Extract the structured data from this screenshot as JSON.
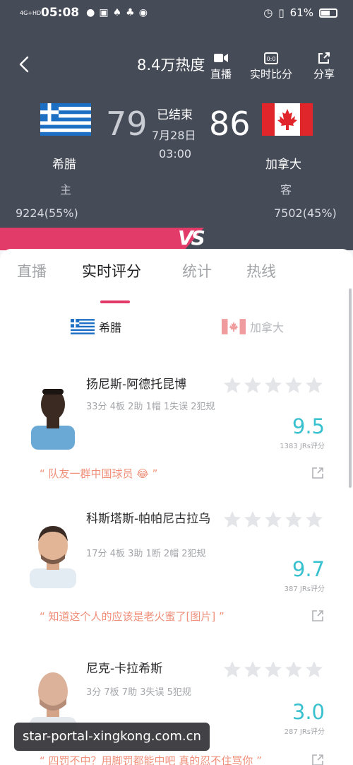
{
  "status_bar": {
    "network": "4G+HD",
    "time": "05:08",
    "battery": "61%",
    "battery_level": 0.61
  },
  "header": {
    "heat": "8.4万热度",
    "actions": {
      "live": "直播",
      "realtime_score": "实时比分",
      "share": "分享"
    },
    "game": {
      "status": "已结束",
      "date": "7月28日",
      "time": "03:00"
    },
    "home": {
      "name": "希腊",
      "role": "主",
      "score": "79",
      "votes": "9224(55%)",
      "support_share": 0.55
    },
    "away": {
      "name": "加拿大",
      "role": "客",
      "score": "86",
      "votes": "7502(45%)",
      "support_share": 0.45
    },
    "vs_label": "VS"
  },
  "tabs": [
    "直播",
    "实时评分",
    "统计",
    "热线"
  ],
  "active_tab": "实时评分",
  "team_switch": {
    "home": "希腊",
    "away": "加拿大"
  },
  "players": [
    {
      "name": "扬尼斯-阿德托昆博",
      "stats": "33分 4板 2助 1帽 1失误 2犯规",
      "rating": "9.5",
      "rating_count": "1383 JRs评分",
      "comment": "“ 队友一群中国球员 😂 ”"
    },
    {
      "name": "科斯塔斯-帕帕尼古拉乌",
      "stats": "17分 4板 3助 1断 2帽 2犯规",
      "rating": "9.7",
      "rating_count": "387 JRs评分",
      "comment": "“ 知道这个人的应该是老火蜜了[图片] ”"
    },
    {
      "name": "尼克-卡拉希斯",
      "stats": "3分 7板 7助 3失误 5犯规",
      "rating": "3.0",
      "rating_count": "287 JRs评分",
      "comment": "“ 四罚不中？用脚罚都能中吧 真的忍不住骂你 ”"
    }
  ],
  "watermark": "star-portal-xingkong.com.cn",
  "colors": {
    "header_bg": "#464b58",
    "accent_pink": "#e23a69",
    "rating_cyan": "#39c1cf",
    "comment_orange": "#f08f7a"
  }
}
